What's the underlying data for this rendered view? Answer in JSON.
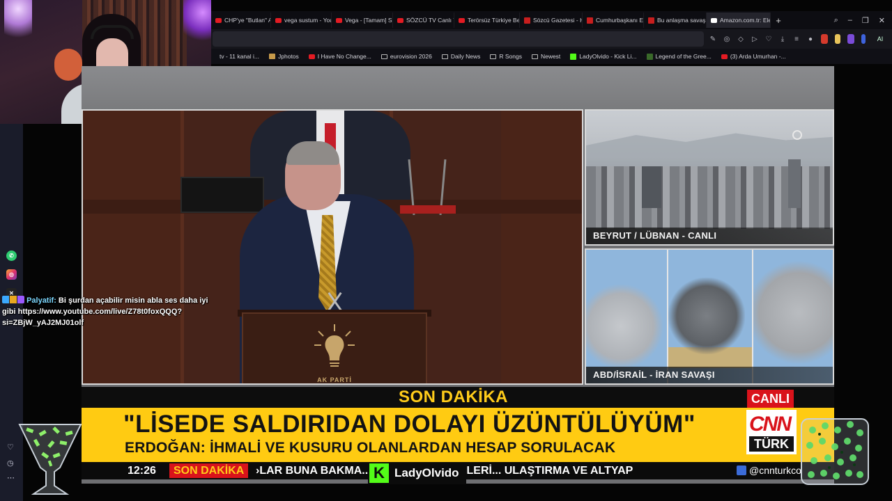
{
  "browser": {
    "tabs": [
      {
        "label": "CHP'ye \"Butlan\" Aç",
        "icon": "youtube-icon"
      },
      {
        "label": "vega sustum - You",
        "icon": "youtube-icon"
      },
      {
        "label": "Vega - [Tamam] Su",
        "icon": "youtube-icon"
      },
      {
        "label": "SÖZCÜ TV Canlı Ya",
        "icon": "youtube-icon"
      },
      {
        "label": "Terörsüz Türkiye Be",
        "icon": "youtube-icon"
      },
      {
        "label": "Sözcü Gazetesi - H",
        "icon": "sozcu-icon"
      },
      {
        "label": "Cumhurbaşkanı Erd",
        "icon": "sozcu-icon"
      },
      {
        "label": "Bu anlaşma savaşın",
        "icon": "sozcu-icon"
      },
      {
        "label": "Amazon.com.tr: Ele",
        "icon": "amazon-icon"
      }
    ],
    "ai_label": "AI",
    "bookmarks": [
      {
        "label": "tv - 11 kanal i...",
        "icon": "none"
      },
      {
        "label": "Jphotos",
        "icon": "image-icon"
      },
      {
        "label": "I Have No Change...",
        "icon": "youtube-icon"
      },
      {
        "label": "eurovision 2026",
        "icon": "folder-icon"
      },
      {
        "label": "Daily News",
        "icon": "folder-icon"
      },
      {
        "label": "R Songs",
        "icon": "folder-icon"
      },
      {
        "label": "Newest",
        "icon": "folder-icon"
      },
      {
        "label": "LadyOlvido - Kick Li...",
        "icon": "kick-icon"
      },
      {
        "label": "Legend of the Gree...",
        "icon": "game-icon"
      },
      {
        "label": "(3) Arda Umurhan -...",
        "icon": "youtube-icon"
      }
    ]
  },
  "broadcast": {
    "live_panels": [
      {
        "caption": "BEYRUT / LÜBNAN - CANLI"
      },
      {
        "caption": "ABD/İSRAİL - İRAN SAVAŞI"
      }
    ],
    "logo_text": "AK PARTİ",
    "breaking_label": "SON DAKİKA",
    "live_badge": "CANLI",
    "headline": "\"LİSEDE SALDIRIDAN DOLAYI ÜZÜNTÜLÜYÜM\"",
    "subheadline": "ERDOĞAN: İHMALİ VE KUSURU OLANLARDAN HESAP SORULACAK",
    "channel_logo_top": "CNN",
    "channel_logo_bottom": "TÜRK",
    "ticker": {
      "time": "12:26",
      "label": "SON DAKİKA",
      "text": "›LAR BUNA BAKMA... DEKİ TÜRK GEMİLERİ... ULAŞTIRMA VE ALTYAP",
      "handle": "@cnnturkco"
    }
  },
  "chat": {
    "username": "Palyatif:",
    "message": "Bi şurdan açabilir misin abla ses daha iyi gibi https://www.youtube.com/live/Z78t0foxQQQ?si=ZBjW_yAJ2MJ01olf"
  },
  "stream_overlay": {
    "channel_name": "LadyOlvido",
    "platform_color": "#53fc18"
  },
  "colors": {
    "cnn_red": "#d9131b",
    "headline_yellow": "#ffcb12",
    "breaking_text_yellow": "#ffcc1a"
  }
}
